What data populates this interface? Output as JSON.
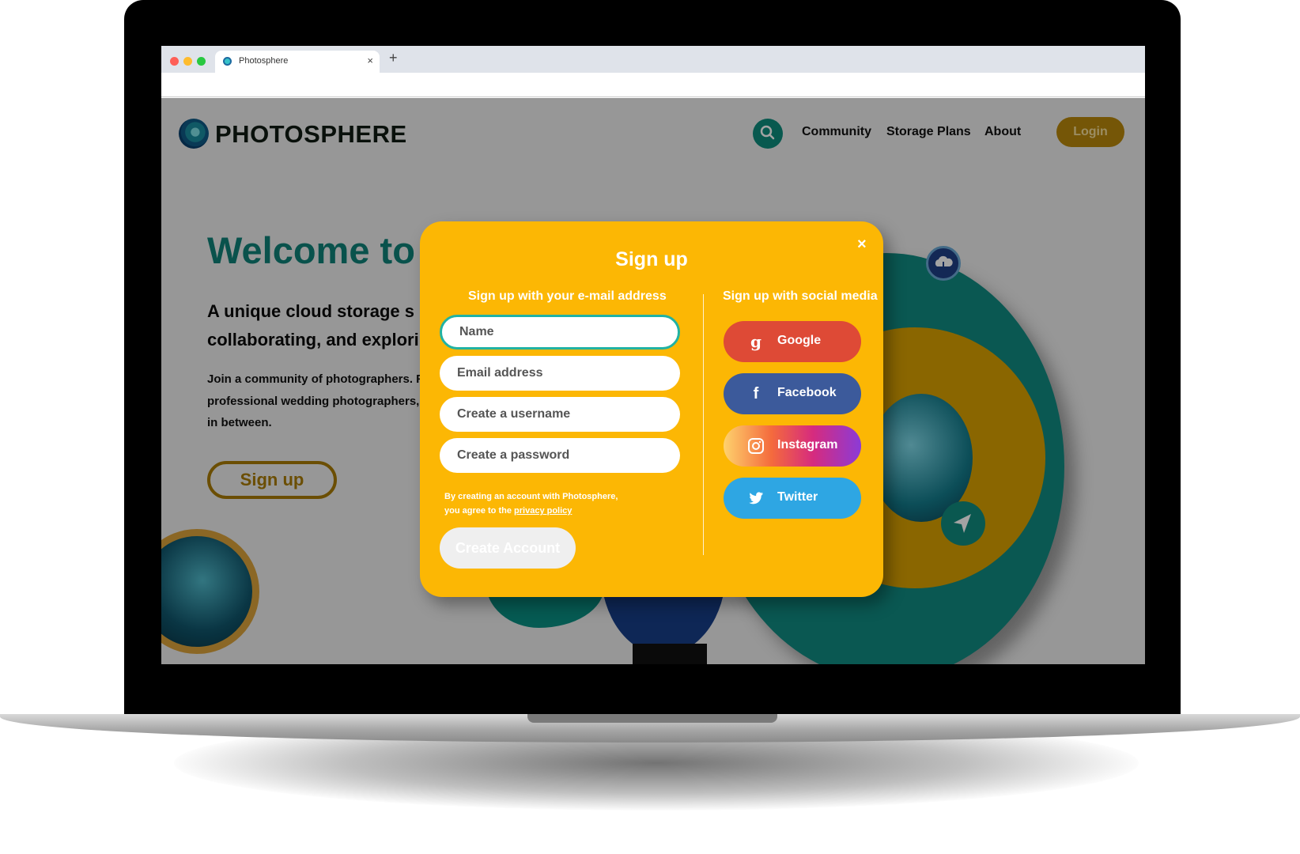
{
  "browser": {
    "tab_title": "Photosphere",
    "tab_close": "×",
    "new_tab": "+"
  },
  "site": {
    "logo_text": "PHOTOSPHERE",
    "nav": {
      "community": "Community",
      "storage_plans": "Storage Plans",
      "about": "About",
      "login": "Login"
    }
  },
  "hero": {
    "title": "Welcome to",
    "subtitle_line1": "A unique cloud storage s",
    "subtitle_line2": "collaborating, and explori",
    "body_line1": "Join a community of photographers. F",
    "body_line2": "professional wedding photographers, ",
    "body_line3": "in between.",
    "signup_label": "Sign up"
  },
  "modal": {
    "title": "Sign up",
    "close": "×",
    "email_heading": "Sign up with your e-mail address",
    "social_heading": "Sign up with social media",
    "fields": {
      "name": "Name",
      "email": "Email address",
      "username": "Create a username",
      "password": "Create a password"
    },
    "terms_line1": "By creating an account with Photosphere,",
    "terms_line2_prefix": "you agree to the ",
    "terms_link": "privacy policy",
    "create_label": "Create Account",
    "social": {
      "google": "Google",
      "facebook": "Facebook",
      "instagram": "Instagram",
      "twitter": "Twitter"
    }
  },
  "colors": {
    "modal_bg": "#fcb704",
    "brand_teal": "#0f8077",
    "google": "#de4a36",
    "facebook": "#3c5a9b",
    "twitter": "#2ea6e3",
    "login": "#b8870b"
  },
  "icons": [
    "search-icon",
    "close-icon",
    "google-icon",
    "facebook-icon",
    "instagram-icon",
    "twitter-icon",
    "cloud-icon",
    "send-icon"
  ]
}
